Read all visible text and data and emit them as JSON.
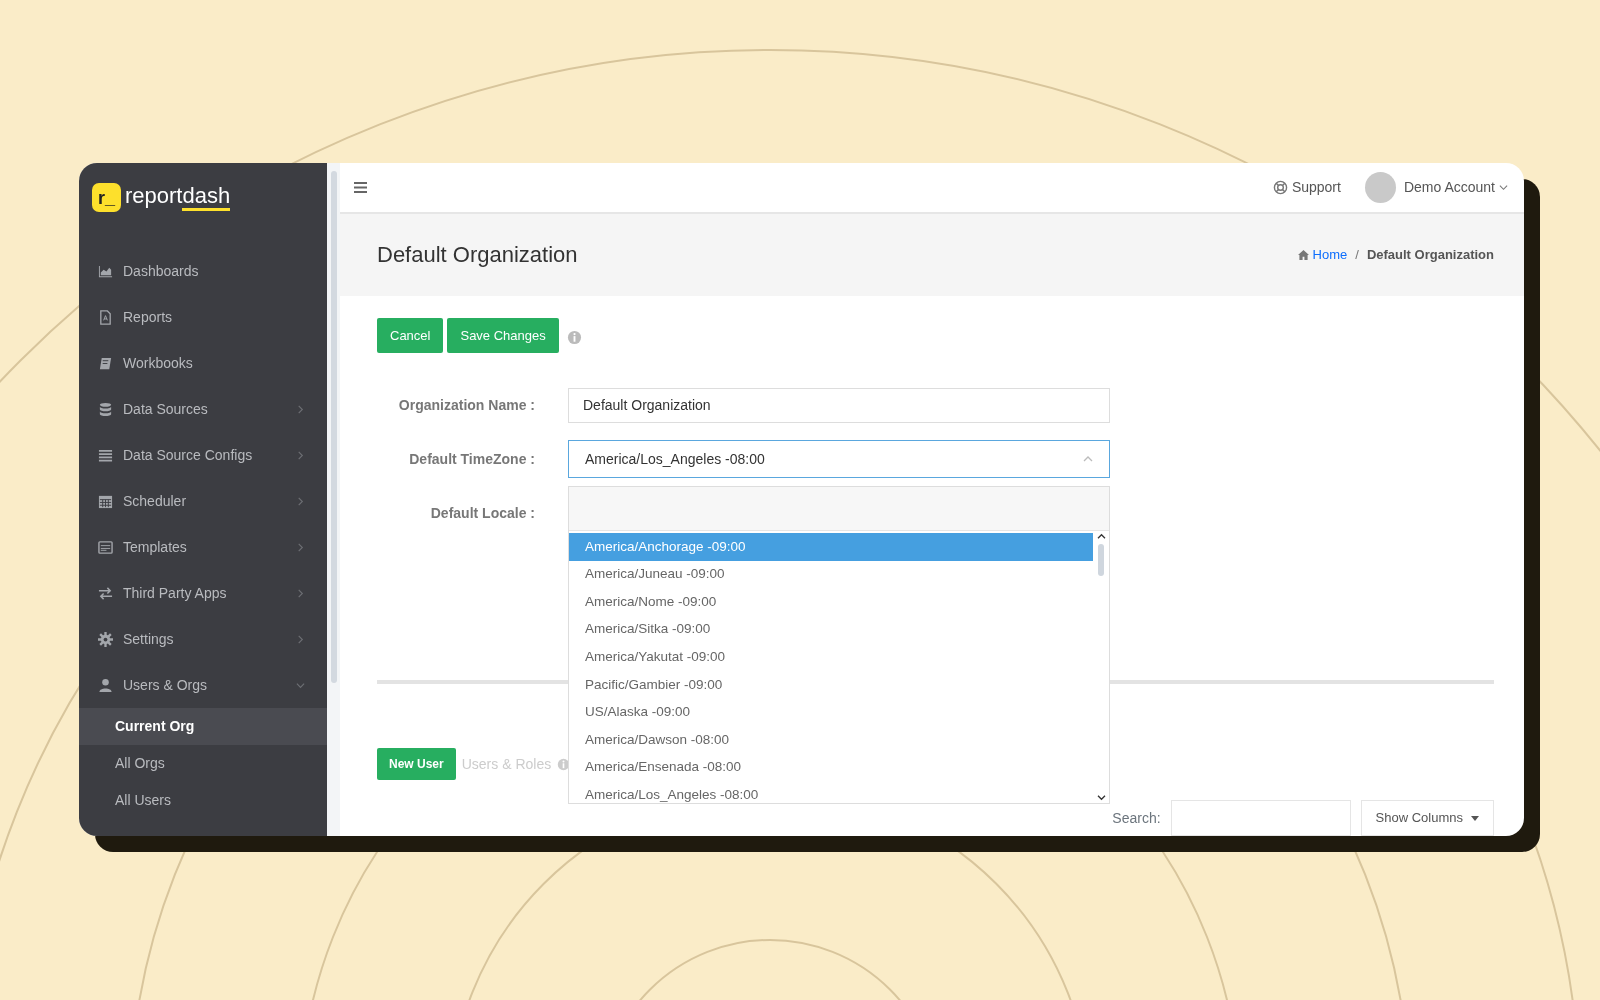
{
  "brand": {
    "mark": "r_",
    "name_plain": "report",
    "name_underlined": "dash"
  },
  "sidebar": {
    "items": [
      {
        "label": "Dashboards",
        "kind": "link"
      },
      {
        "label": "Reports",
        "kind": "link"
      },
      {
        "label": "Workbooks",
        "kind": "link"
      },
      {
        "label": "Data Sources",
        "kind": "group",
        "expanded": false
      },
      {
        "label": "Data Source Configs",
        "kind": "group",
        "expanded": false
      },
      {
        "label": "Scheduler",
        "kind": "group",
        "expanded": false
      },
      {
        "label": "Templates",
        "kind": "group",
        "expanded": false
      },
      {
        "label": "Third Party Apps",
        "kind": "group",
        "expanded": false
      },
      {
        "label": "Settings",
        "kind": "group",
        "expanded": false
      },
      {
        "label": "Users & Orgs",
        "kind": "group",
        "expanded": true,
        "children": [
          {
            "label": "Current Org",
            "selected": true
          },
          {
            "label": "All Orgs",
            "selected": false
          },
          {
            "label": "All Users",
            "selected": false
          }
        ]
      }
    ]
  },
  "topbar": {
    "support": "Support",
    "account": "Demo Account"
  },
  "page_header": {
    "title": "Default Organization",
    "separator": "/",
    "breadcrumb": [
      {
        "label": "Home",
        "current": false
      },
      {
        "label": "Default Organization",
        "current": true
      }
    ]
  },
  "actions": [
    "Cancel",
    "Save Changes"
  ],
  "form": {
    "fields": [
      {
        "label": "Organization Name :",
        "kind": "text",
        "value": "Default Organization"
      },
      {
        "label": "Default TimeZone :",
        "kind": "select",
        "value": "America/Los_Angeles -08:00",
        "expanded": true
      },
      {
        "label": "Default Locale :",
        "kind": "hidden"
      }
    ]
  },
  "timezone_options": [
    {
      "label": "America/Anchorage -09:00",
      "selected": true
    },
    {
      "label": "America/Juneau -09:00",
      "selected": false
    },
    {
      "label": "America/Nome -09:00",
      "selected": false
    },
    {
      "label": "America/Sitka -09:00",
      "selected": false
    },
    {
      "label": "America/Yakutat -09:00",
      "selected": false
    },
    {
      "label": "Pacific/Gambier -09:00",
      "selected": false
    },
    {
      "label": "US/Alaska -09:00",
      "selected": false
    },
    {
      "label": "America/Dawson -08:00",
      "selected": false
    },
    {
      "label": "America/Ensenada -08:00",
      "selected": false
    },
    {
      "label": "America/Los_Angeles -08:00",
      "selected": false
    }
  ],
  "users": {
    "new_button": "New User",
    "heading": "Users & Roles",
    "search_label": "Search:",
    "columns_button": "Show Columns"
  }
}
